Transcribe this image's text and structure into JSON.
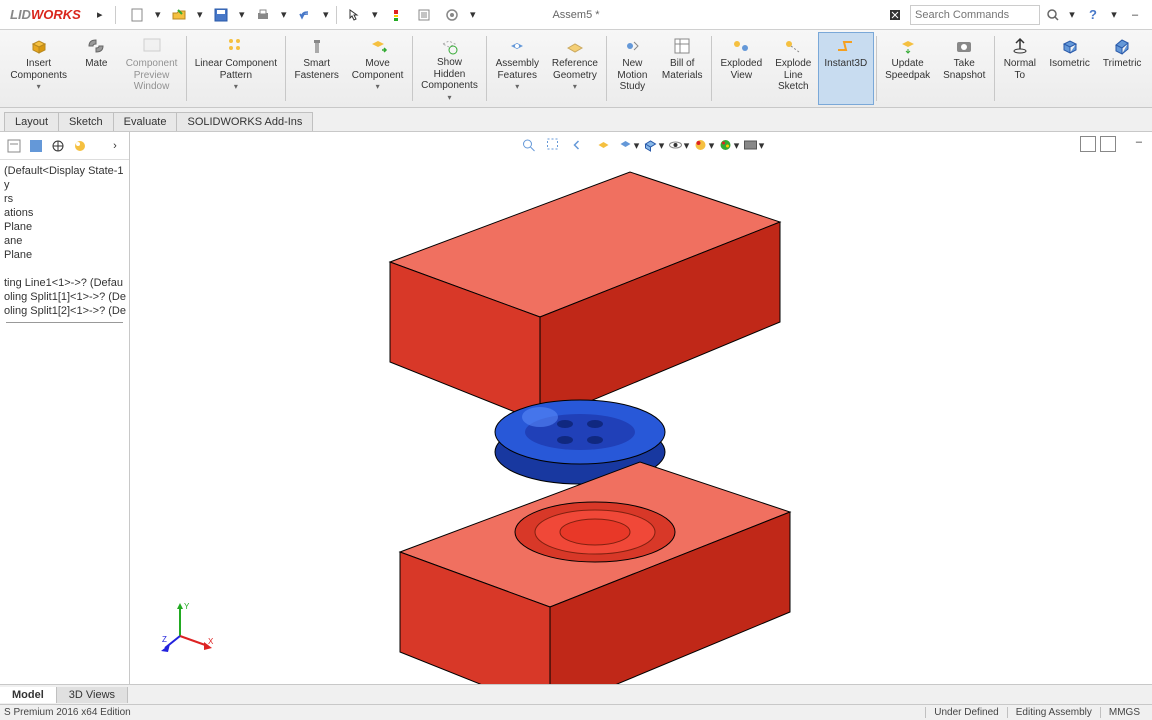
{
  "titlebar": {
    "logo_prefix": "LID",
    "logo_suffix": "WORKS",
    "doc_title": "Assem5 *",
    "search_placeholder": "Search Commands"
  },
  "ribbon": {
    "insert_components": "Insert\nComponents",
    "mate": "Mate",
    "component_preview": "Component\nPreview\nWindow",
    "linear_pattern": "Linear Component\nPattern",
    "smart_fasteners": "Smart\nFasteners",
    "move_component": "Move\nComponent",
    "show_hidden": "Show\nHidden\nComponents",
    "assembly_features": "Assembly\nFeatures",
    "reference_geometry": "Reference\nGeometry",
    "new_motion": "New\nMotion\nStudy",
    "bom": "Bill of\nMaterials",
    "exploded_view": "Exploded\nView",
    "explode_line": "Explode\nLine\nSketch",
    "instant3d": "Instant3D",
    "update_speedpak": "Update\nSpeedpak",
    "take_snapshot": "Take\nSnapshot",
    "normal_to": "Normal\nTo",
    "isometric": "Isometric",
    "trimetric": "Trimetric"
  },
  "tabs": {
    "layout": "Layout",
    "sketch": "Sketch",
    "evaluate": "Evaluate",
    "addins": "SOLIDWORKS Add-Ins"
  },
  "tree": {
    "item0": "(Default<Display State-1",
    "item1": "y",
    "item2": "rs",
    "item3": "ations",
    "item4": "Plane",
    "item5": "ane",
    "item6": "Plane",
    "item7": "ting Line1<1>->? (Defau",
    "item8": "oling Split1[1]<1>->? (De",
    "item9": "oling Split1[2]<1>->? (De"
  },
  "bottom_tabs": {
    "model": "Model",
    "views3d": "3D Views"
  },
  "status": {
    "left": "S Premium 2016 x64 Edition",
    "under_defined": "Under Defined",
    "editing": "Editing Assembly",
    "units": "MMGS"
  }
}
